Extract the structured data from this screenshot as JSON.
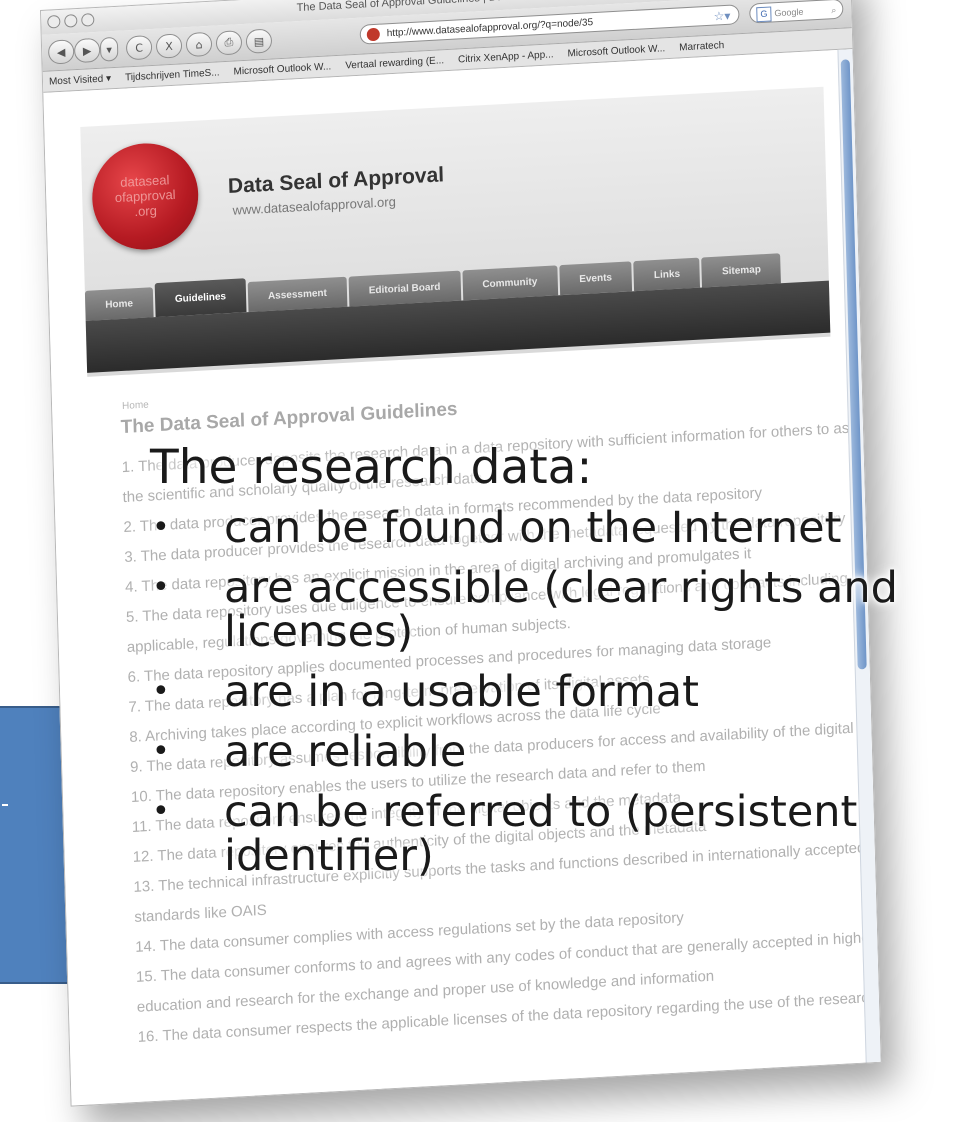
{
  "browser": {
    "window_title": "The Data Seal of Approval Guidelines | Data Seal of Approval",
    "url": "http://www.datasealofapproval.org/?q=node/35",
    "search_placeholder": "Google",
    "nav_buttons": {
      "back": "◀",
      "forward": "▶",
      "dropdown": "▾",
      "reload": "C",
      "stop": "X",
      "home": "⌂",
      "print": "⎙",
      "save": "▤"
    },
    "bookmarks": [
      "Most Visited ▾",
      "Tijdschrijven TimeS...",
      "Microsoft Outlook W...",
      "Vertaal rewarding (E...",
      "Citrix XenApp - App...",
      "Microsoft Outlook W...",
      "Marratech"
    ]
  },
  "site": {
    "logo_text": "datasealofapproval.org",
    "title": "Data Seal of Approval",
    "url": "www.datasealofapproval.org",
    "nav_tabs": [
      {
        "label": "Home"
      },
      {
        "label": "Guidelines"
      },
      {
        "label": "Assessment"
      },
      {
        "label": "Editorial Board"
      },
      {
        "label": "Community"
      },
      {
        "label": "Events"
      },
      {
        "label": "Links"
      },
      {
        "label": "Sitemap"
      }
    ],
    "active_tab": "Guidelines",
    "breadcrumb": "Home",
    "page_heading": "The Data Seal of Approval Guidelines",
    "guidelines": [
      "1. The data producer deposits the research data in a data repository with sufficient information for others to assess",
      "the scientific and scholarly quality of the research data.",
      "2. The data producer provides the research data in formats recommended by the data repository",
      "3. The data producer provides the research data together with the metadata requested by the data repository",
      "4. The data repository has an explicit mission in the area of digital archiving and promulgates it",
      "5. The data repository uses due diligence to ensure compliance with legal regulations and contracts including, when",
      "applicable, regulations governing the protection of human subjects.",
      "6. The data repository applies documented processes and procedures for managing data storage",
      "7. The data repository has a plan for long-term preservation of its digital assets",
      "8. Archiving takes place according to explicit workflows across the data life cycle",
      "9. The data repository assumes responsibility from the data producers for access and availability of the digital objects",
      "10. The data repository enables the users to utilize the research data and refer to them",
      "11. The data repository ensures the integrity of the digital objects and the metadata",
      "12. The data repository ensures the authenticity of the digital objects and the metadata",
      "13. The technical infrastructure explicitly supports the tasks and functions described in internationally accepted archival",
      "standards like OAIS",
      "14. The data consumer complies with access regulations set by the data repository",
      "15. The data consumer conforms to and agrees with any codes of conduct that are generally accepted in higher",
      "education and research for the exchange and proper use of knowledge and information",
      "16. The data consumer respects the applicable licenses of the data repository regarding the use of the research data"
    ]
  },
  "overlay": {
    "heading": "The research data:",
    "bullet_glyph": "•",
    "bullets": [
      "can be found on the Internet",
      "are accessible (clear rights and licenses)",
      "are in a usable format",
      "are reliable",
      "can be referred to (persistent identifier)"
    ]
  },
  "colors": {
    "blue_box": "#4f81bd",
    "seal_red": "#c0232b",
    "nav_dark": "#3a3a3a"
  }
}
